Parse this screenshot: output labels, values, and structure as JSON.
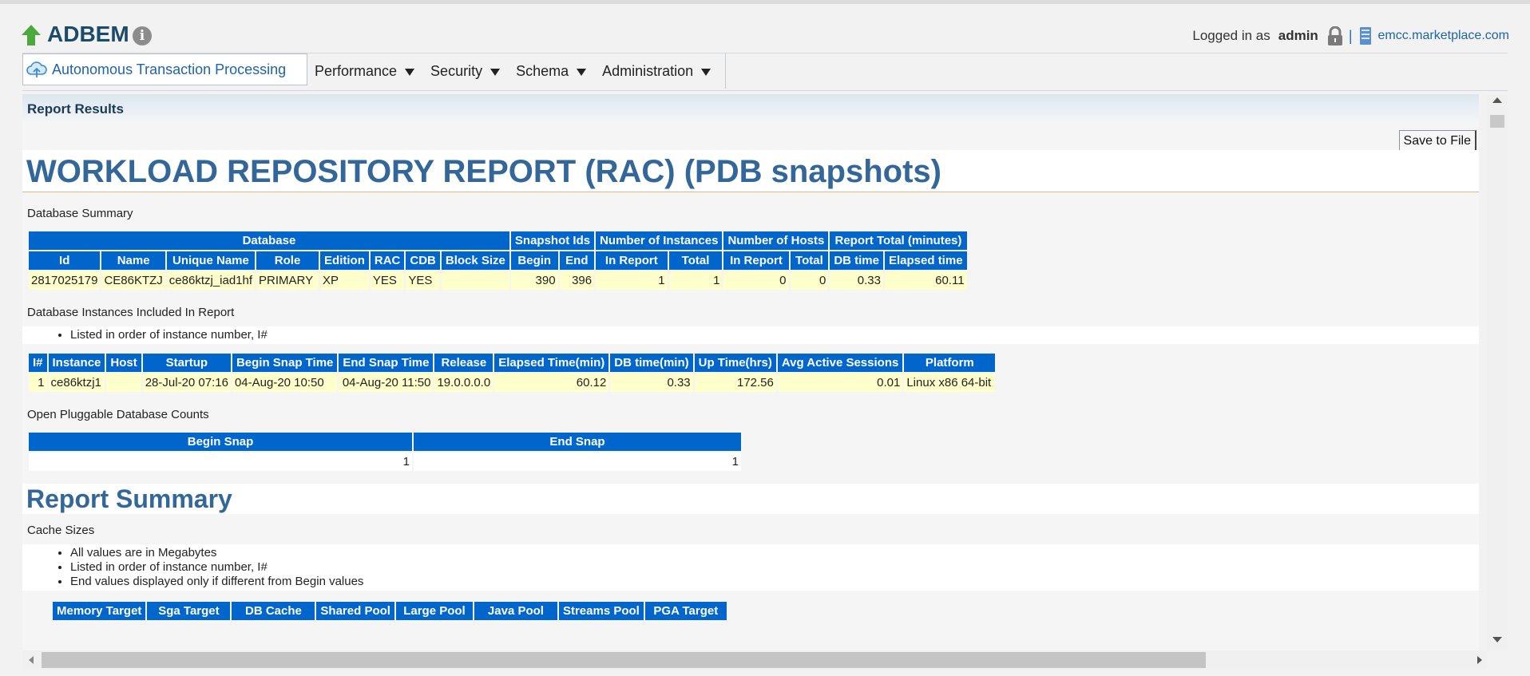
{
  "header": {
    "app_title": "ADBEM",
    "logged_in_label": "Logged in as",
    "username": "admin",
    "separator": "|",
    "host": "emcc.marketplace.com"
  },
  "menubar": {
    "target": "Autonomous Transaction Processing",
    "items": [
      {
        "label": "Performance"
      },
      {
        "label": "Security"
      },
      {
        "label": "Schema"
      },
      {
        "label": "Administration"
      }
    ]
  },
  "region": {
    "title": "Report Results",
    "save_button": "Save to File"
  },
  "report": {
    "title": "WORKLOAD REPOSITORY REPORT (RAC) (PDB snapshots)",
    "db_summary": {
      "caption": "Database Summary",
      "group_headers": [
        "Database",
        "Snapshot Ids",
        "Number of Instances",
        "Number of Hosts",
        "Report Total (minutes)"
      ],
      "headers": [
        "Id",
        "Name",
        "Unique Name",
        "Role",
        "Edition",
        "RAC",
        "CDB",
        "Block Size",
        "Begin",
        "End",
        "In Report",
        "Total",
        "In Report",
        "Total",
        "DB time",
        "Elapsed time"
      ],
      "row": [
        "2817025179",
        "CE86KTZJ",
        "ce86ktzj_iad1hf",
        "PRIMARY",
        "XP",
        "YES",
        "YES",
        "",
        "390",
        "396",
        "1",
        "1",
        "0",
        "0",
        "0.33",
        "60.11"
      ]
    },
    "instances": {
      "caption": "Database Instances Included In Report",
      "notes": [
        "Listed in order of instance number, I#"
      ],
      "headers": [
        "I#",
        "Instance",
        "Host",
        "Startup",
        "Begin Snap Time",
        "End Snap Time",
        "Release",
        "Elapsed Time(min)",
        "DB time(min)",
        "Up Time(hrs)",
        "Avg Active Sessions",
        "Platform"
      ],
      "row": [
        "1",
        "ce86ktzj1",
        "",
        "28-Jul-20 07:16",
        "04-Aug-20 10:50",
        "04-Aug-20 11:50",
        "19.0.0.0.0",
        "60.12",
        "0.33",
        "172.56",
        "0.01",
        "Linux x86 64-bit"
      ]
    },
    "pdb_counts": {
      "caption": "Open Pluggable Database Counts",
      "headers": [
        "Begin Snap",
        "End Snap"
      ],
      "row": [
        "1",
        "1"
      ]
    },
    "summary_title": "Report Summary",
    "cache_sizes": {
      "caption": "Cache Sizes",
      "notes": [
        "All values are in Megabytes",
        "Listed in order of instance number, I#",
        "End values displayed only if different from Begin values"
      ],
      "headers": [
        "Memory Target",
        "Sga Target",
        "DB Cache",
        "Shared Pool",
        "Large Pool",
        "Java Pool",
        "Streams Pool",
        "PGA Target"
      ]
    }
  }
}
